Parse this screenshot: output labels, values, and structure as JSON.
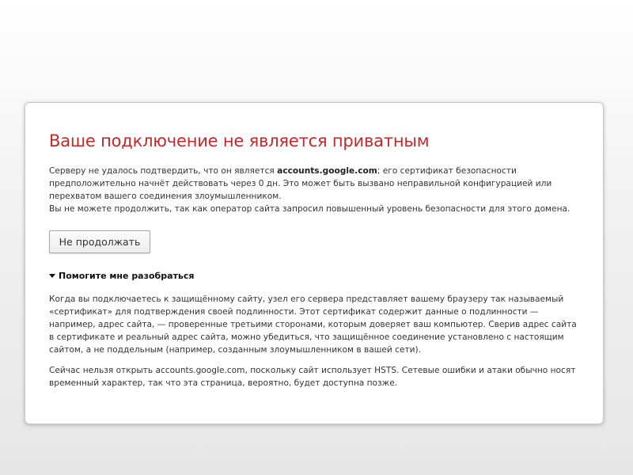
{
  "error": {
    "title": "Ваше подключение не является приватным",
    "main_prefix": "Серверу не удалось подтвердить, что он является ",
    "domain": "accounts.google.com",
    "main_suffix": "; его сертификат безопасности предположительно начнёт действовать через 0 дн. Это может быть вызвано неправильной конфигурацией или перехватом вашего соединения злоумышленником.",
    "main_line2": "Вы не можете продолжить, так как оператор сайта запросил повышенный уровень безопасности для этого домена.",
    "button_label": "Не продолжать",
    "details_toggle": "Помогите мне разобраться",
    "details_p1": "Когда вы подключаетесь к защищённому сайту, узел его сервера представляет вашему браузеру так называемый «сертификат» для подтверждения своей подлинности. Этот сертификат содержит данные о подлинности — например, адрес сайта, — проверенные третьими сторонами, которым доверяет ваш компьютер. Сверив адрес сайта в сертификате и реальный адрес сайта, можно убедиться, что защищённое соединение установлено с настоящим сайтом, а не поддельным (например, созданным злоумышленником в вашей сети).",
    "details_p2": "Сейчас нельзя открыть accounts.google.com, поскольку сайт использует HSTS. Сетевые ошибки и атаки обычно носят временный характер, так что эта страница, вероятно, будет доступна позже."
  },
  "icons": {
    "details_toggle_icon": "triangle-down-icon"
  }
}
